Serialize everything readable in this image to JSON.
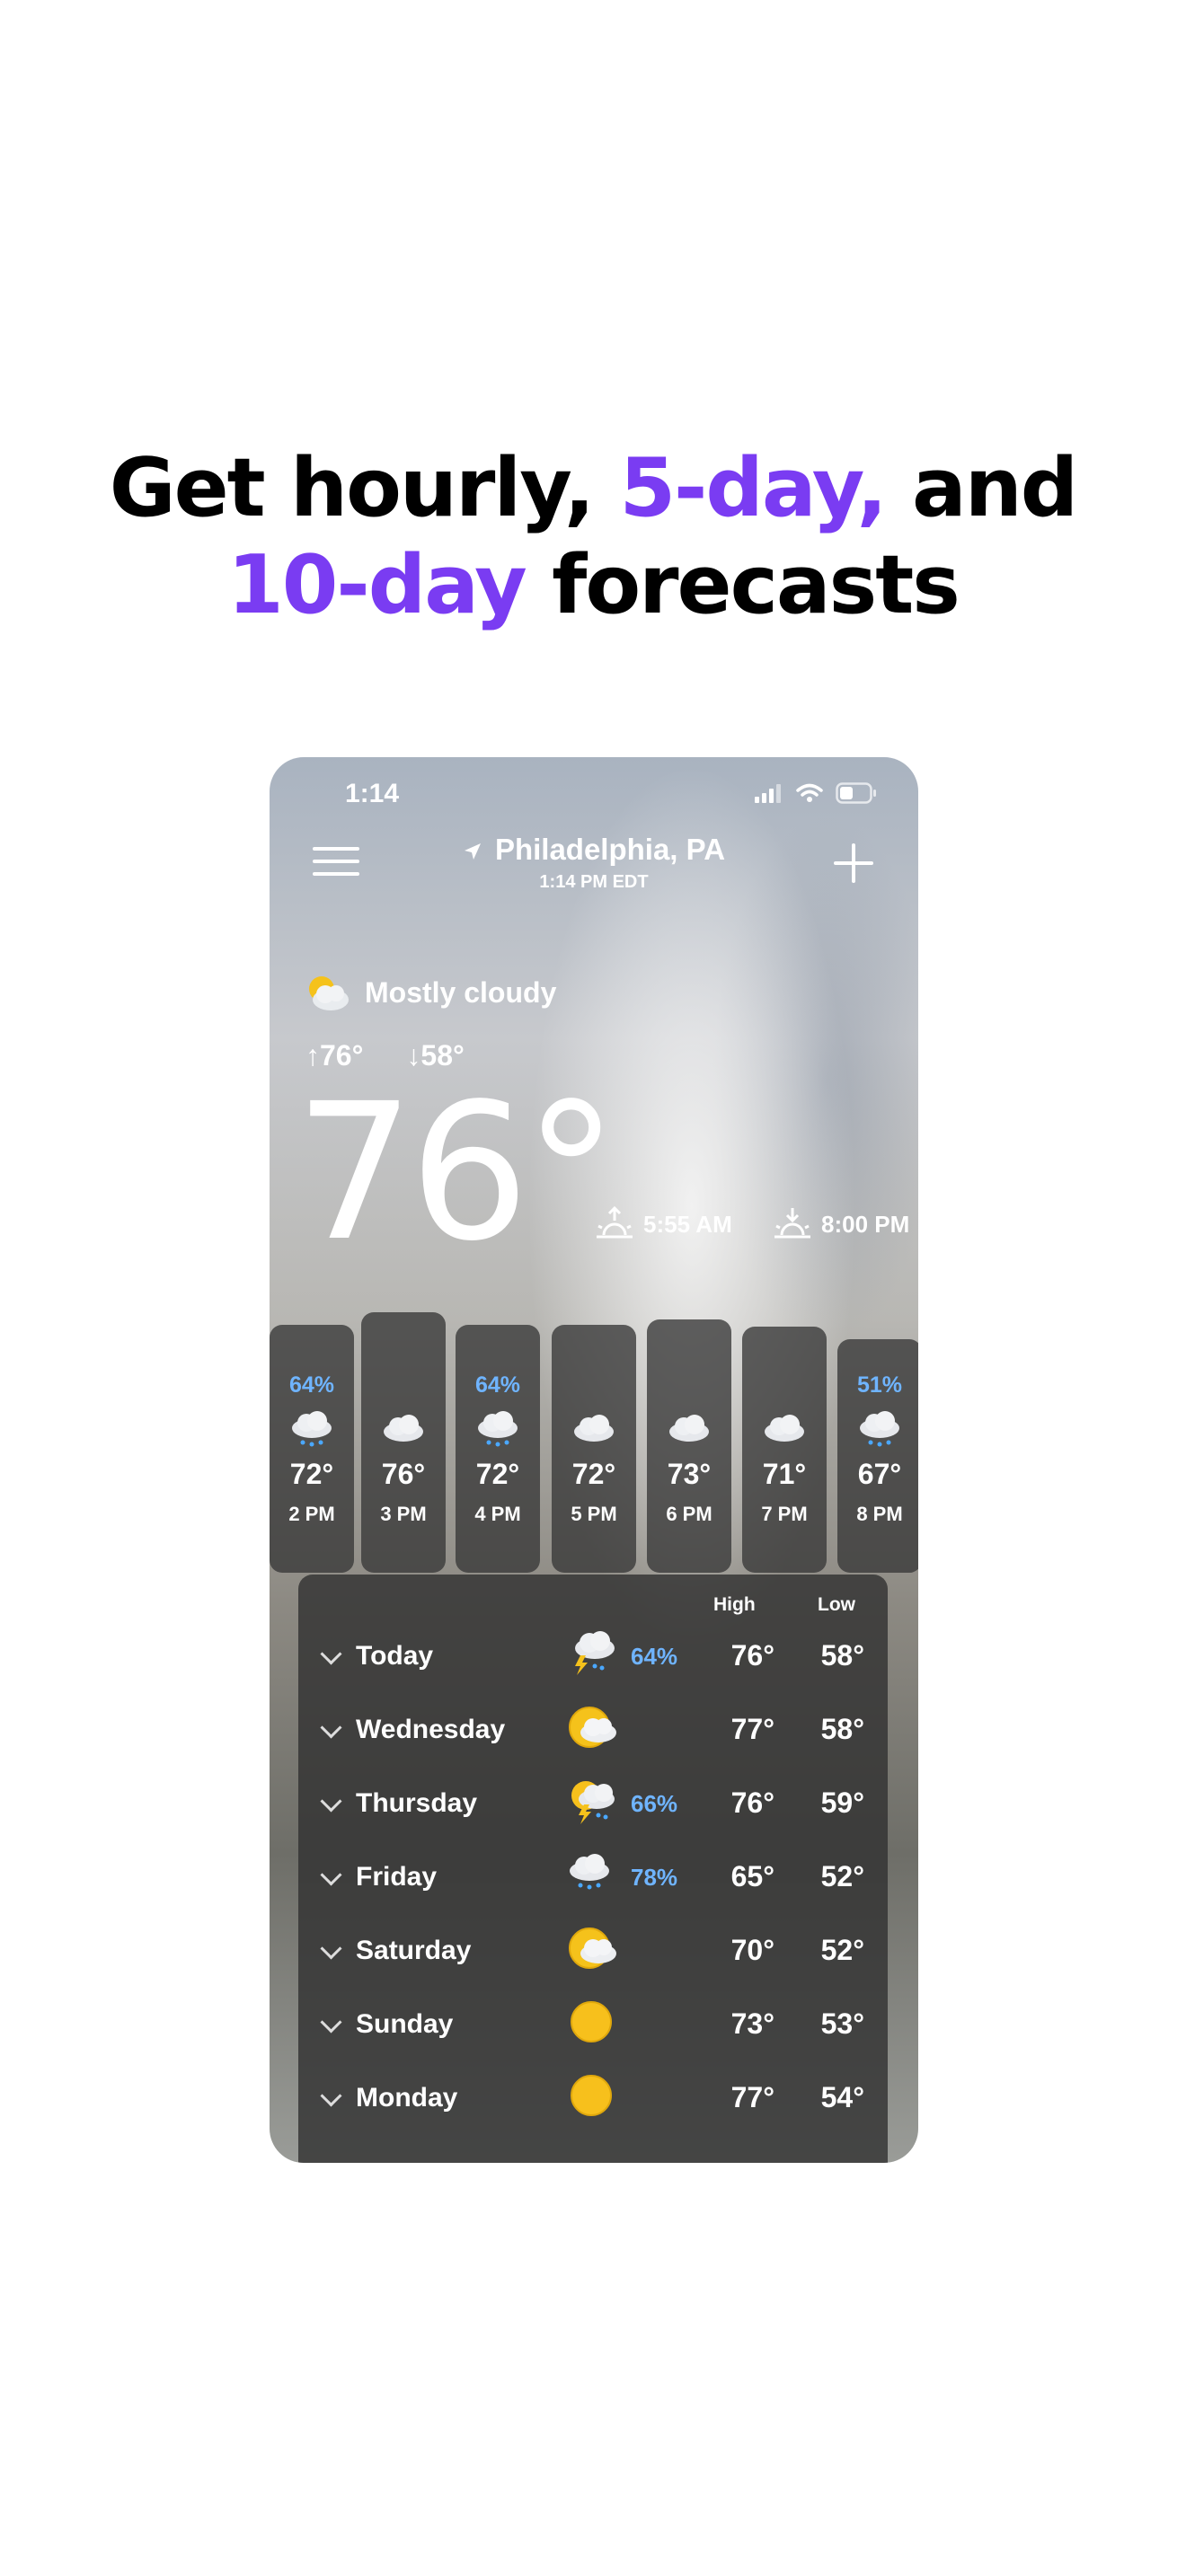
{
  "headline": {
    "part1": "Get hourly, ",
    "accent1": "5-day,",
    "part2": " and",
    "accent2": "10-day",
    "part3": " forecasts"
  },
  "colors": {
    "accent": "#7a3cf2",
    "precip": "#6fb4ff"
  },
  "status": {
    "time": "1:14"
  },
  "location": {
    "name": "Philadelphia, PA",
    "time": "1:14 PM EDT"
  },
  "current": {
    "condition": "Mostly cloudy",
    "high": "76°",
    "low": "58°",
    "temp": "76°",
    "sunrise": "5:55 AM",
    "sunset": "8:00 PM"
  },
  "hourly": [
    {
      "pop": "64%",
      "icon": "rain-cloud-icon",
      "temp": "72°",
      "hour": "2 PM"
    },
    {
      "pop": "",
      "icon": "cloud-icon",
      "temp": "76°",
      "hour": "3 PM"
    },
    {
      "pop": "64%",
      "icon": "rain-cloud-icon",
      "temp": "72°",
      "hour": "4 PM"
    },
    {
      "pop": "",
      "icon": "cloud-icon",
      "temp": "72°",
      "hour": "5 PM"
    },
    {
      "pop": "",
      "icon": "cloud-icon",
      "temp": "73°",
      "hour": "6 PM"
    },
    {
      "pop": "",
      "icon": "cloud-icon",
      "temp": "71°",
      "hour": "7 PM"
    },
    {
      "pop": "51%",
      "icon": "rain-cloud-icon",
      "temp": "67°",
      "hour": "8 PM"
    }
  ],
  "daily": {
    "high_label": "High",
    "low_label": "Low",
    "rows": [
      {
        "day": "Today",
        "icon": "thunderstorm-icon",
        "pop": "64%",
        "high": "76°",
        "low": "58°"
      },
      {
        "day": "Wednesday",
        "icon": "partly-cloudy-icon",
        "pop": "",
        "high": "77°",
        "low": "58°"
      },
      {
        "day": "Thursday",
        "icon": "sun-thunderstorm-icon",
        "pop": "66%",
        "high": "76°",
        "low": "59°"
      },
      {
        "day": "Friday",
        "icon": "rain-cloud-icon",
        "pop": "78%",
        "high": "65°",
        "low": "52°"
      },
      {
        "day": "Saturday",
        "icon": "partly-cloudy-icon",
        "pop": "",
        "high": "70°",
        "low": "52°"
      },
      {
        "day": "Sunday",
        "icon": "sun-icon",
        "pop": "",
        "high": "73°",
        "low": "53°"
      },
      {
        "day": "Monday",
        "icon": "sun-icon",
        "pop": "",
        "high": "77°",
        "low": "54°"
      }
    ]
  }
}
